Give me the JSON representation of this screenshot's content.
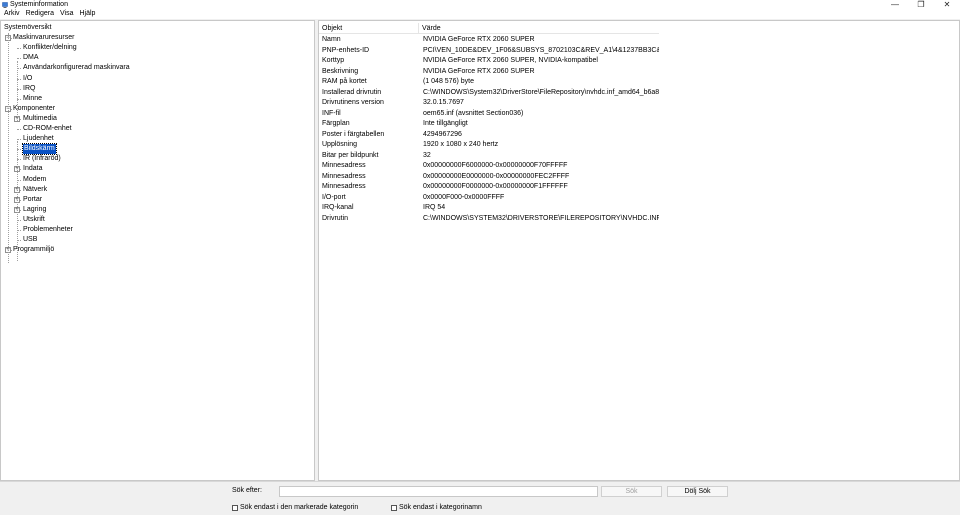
{
  "window": {
    "title": "Systeminformation",
    "minimize": "—",
    "maximize": "❐",
    "close": "✕"
  },
  "menu": [
    "Arkiv",
    "Redigera",
    "Visa",
    "Hjälp"
  ],
  "tree": {
    "items": [
      {
        "label": "Systemöversikt",
        "level": 0,
        "toggle": ""
      },
      {
        "label": "Maskinvaruresurser",
        "level": 1,
        "toggle": "−"
      },
      {
        "label": "Konflikter/delning",
        "level": 2,
        "toggle": ""
      },
      {
        "label": "DMA",
        "level": 2,
        "toggle": ""
      },
      {
        "label": "Användarkonfigurerad maskinvara",
        "level": 2,
        "toggle": ""
      },
      {
        "label": "I/O",
        "level": 2,
        "toggle": ""
      },
      {
        "label": "IRQ",
        "level": 2,
        "toggle": ""
      },
      {
        "label": "Minne",
        "level": 2,
        "toggle": ""
      },
      {
        "label": "Komponenter",
        "level": 1,
        "toggle": "−"
      },
      {
        "label": "Multimedia",
        "level": 2,
        "toggle": "+"
      },
      {
        "label": "CD-ROM-enhet",
        "level": 2,
        "toggle": ""
      },
      {
        "label": "Ljudenhet",
        "level": 2,
        "toggle": ""
      },
      {
        "label": "Bildskärm",
        "level": 2,
        "toggle": "",
        "selected": true
      },
      {
        "label": "IR (Infraröd)",
        "level": 2,
        "toggle": ""
      },
      {
        "label": "Indata",
        "level": 2,
        "toggle": "+"
      },
      {
        "label": "Modem",
        "level": 2,
        "toggle": ""
      },
      {
        "label": "Nätverk",
        "level": 2,
        "toggle": "+"
      },
      {
        "label": "Portar",
        "level": 2,
        "toggle": "+"
      },
      {
        "label": "Lagring",
        "level": 2,
        "toggle": "+"
      },
      {
        "label": "Utskrift",
        "level": 2,
        "toggle": ""
      },
      {
        "label": "Problemenheter",
        "level": 2,
        "toggle": ""
      },
      {
        "label": "USB",
        "level": 2,
        "toggle": ""
      },
      {
        "label": "Programmiljö",
        "level": 1,
        "toggle": "+"
      }
    ]
  },
  "details": {
    "headers": [
      "Objekt",
      "Värde"
    ],
    "rows": [
      [
        "Namn",
        "NVIDIA GeForce RTX 2060 SUPER"
      ],
      [
        "PNP-enhets-ID",
        "PCI\\VEN_10DE&DEV_1F06&SUBSYS_8702103C&REV_A1\\4&1237BB3C&0&0019"
      ],
      [
        "Korttyp",
        "NVIDIA GeForce RTX 2060 SUPER, NVIDIA-kompatibel"
      ],
      [
        "Beskrivning",
        "NVIDIA GeForce RTX 2060 SUPER"
      ],
      [
        "RAM på kortet",
        "(1 048 576) byte"
      ],
      [
        "Installerad drivrutin",
        "C:\\WINDOWS\\System32\\DriverStore\\FileRepository\\nvhdc.inf_amd64_b6a81ea..."
      ],
      [
        "Drivrutinens version",
        "32.0.15.7697"
      ],
      [
        "INF-fil",
        "oem65.inf (avsnittet Section036)"
      ],
      [
        "Färgplan",
        "Inte tillgängligt"
      ],
      [
        "Poster i färgtabellen",
        "4294967296"
      ],
      [
        "Upplösning",
        "1920 x 1080 x 240 hertz"
      ],
      [
        "Bitar per bildpunkt",
        "32"
      ],
      [
        "Minnesadress",
        "0x00000000F6000000-0x00000000F70FFFFF"
      ],
      [
        "Minnesadress",
        "0x00000000E0000000-0x00000000FEC2FFFF"
      ],
      [
        "Minnesadress",
        "0x00000000F0000000-0x00000000F1FFFFFF"
      ],
      [
        "I/O-port",
        "0x0000F000-0x0000FFFF"
      ],
      [
        "IRQ-kanal",
        "IRQ 54"
      ],
      [
        "Drivrutin",
        "C:\\WINDOWS\\SYSTEM32\\DRIVERSTORE\\FILEREPOSITORY\\NVHDC.INF_AMD64..."
      ]
    ]
  },
  "search": {
    "label": "Sök efter:",
    "value": "",
    "search_button": "Sök",
    "hide_button": "Dölj Sök",
    "option_selected_category": "Sök endast i den markerade kategorin",
    "option_category_names": "Sök endast i kategorinamn"
  }
}
